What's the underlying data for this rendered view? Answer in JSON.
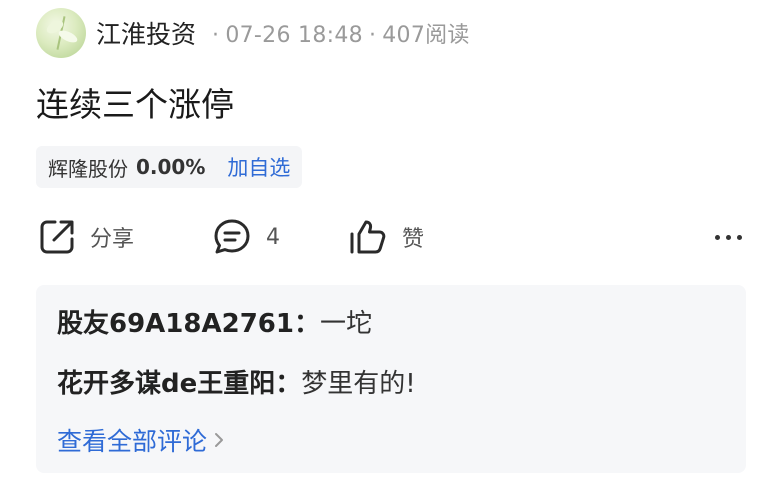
{
  "post": {
    "author": "江淮投资",
    "date": "07-26 18:48",
    "reads": "407阅读",
    "separator": "·",
    "title": "连续三个涨停"
  },
  "stock_tag": {
    "name": "辉隆股份",
    "change": "0.00%",
    "add_label": "加自选"
  },
  "actions": {
    "share_label": "分享",
    "comment_count": "4",
    "like_label": "赞"
  },
  "comments": [
    {
      "user": "股友69A18A2761",
      "colon": "：",
      "text": "一坨"
    },
    {
      "user": "花开多谋de王重阳",
      "colon": "：",
      "text": "梦里有的!"
    }
  ],
  "view_all_label": "查看全部评论",
  "colors": {
    "link_blue": "#2f6bd6",
    "meta_gray": "#9a9a9a",
    "tag_bg": "#f4f5f7",
    "comment_bg": "#f6f7f9"
  },
  "icons": [
    "share-icon",
    "comment-icon",
    "like-icon",
    "more-icon",
    "chevron-right-icon"
  ]
}
